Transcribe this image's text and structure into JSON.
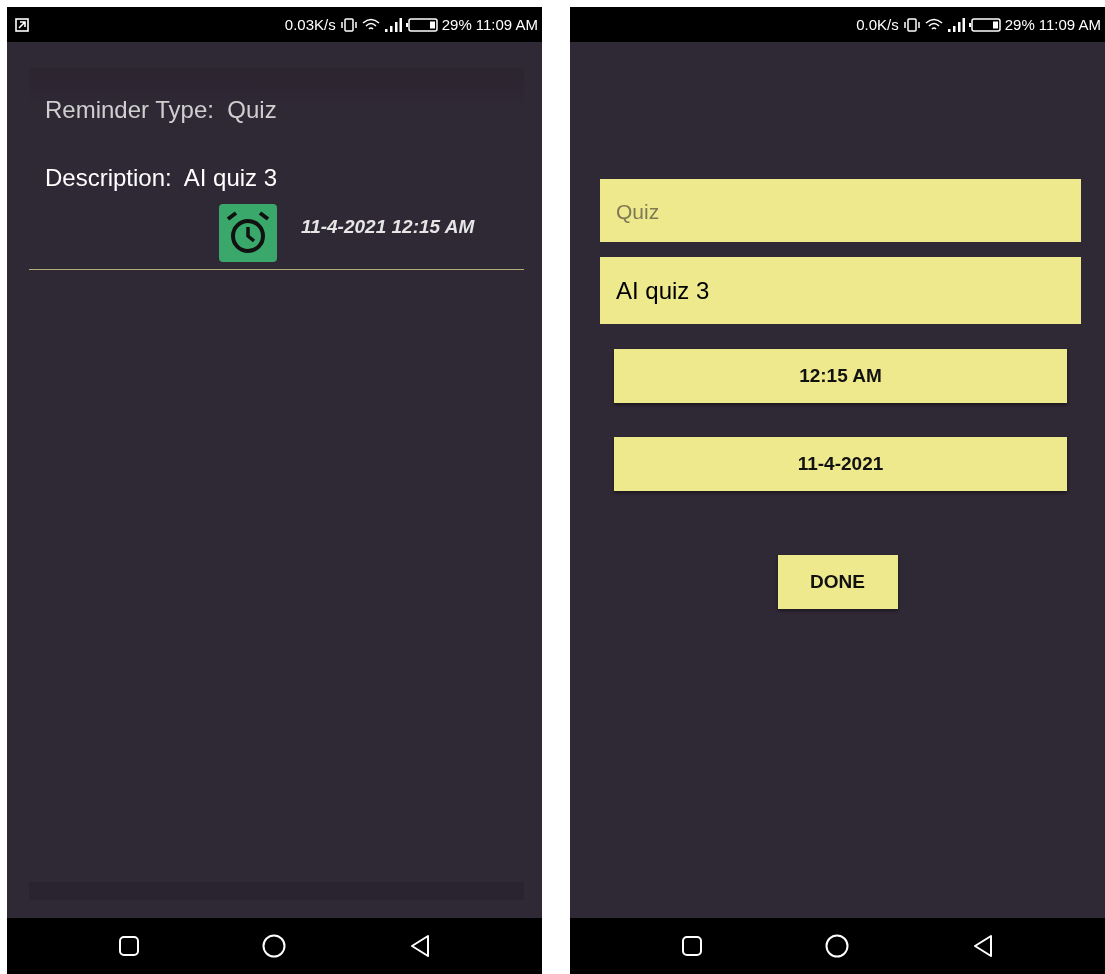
{
  "reminder_list_screen": {
    "status_bar": {
      "speed": "0.03K/s",
      "battery": "29%",
      "time": "11:09 AM"
    },
    "reminder": {
      "type_label": "Reminder Type:",
      "type_value": "Quiz",
      "description_label": "Description:",
      "description_value": "AI quiz 3",
      "due": "11-4-2021 12:15 AM"
    }
  },
  "edit_screen": {
    "status_bar": {
      "speed": "0.0K/s",
      "battery": "29%",
      "time": "11:09 AM"
    },
    "type_field": {
      "placeholder": "Quiz"
    },
    "description_field": {
      "value": "AI quiz 3"
    },
    "time_button": "12:15 AM",
    "date_button": "11-4-2021",
    "done_button": "DONE"
  }
}
